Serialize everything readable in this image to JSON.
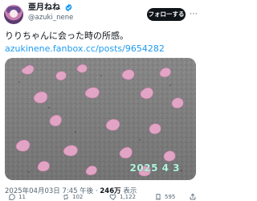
{
  "profile": {
    "display_name": "亜月ねね",
    "handle": "@azuki_nene",
    "verified": true,
    "follow_label": "フォローする",
    "more_icon": "more-icon"
  },
  "tweet": {
    "text": "りりちゃんに会った時の所感。",
    "link": "azukinene.fanbox.cc/posts/9654282",
    "media": {
      "type": "photo",
      "stamp_text": "2025 4 3"
    },
    "meta": {
      "timestamp": "2025年04月03日 7:45 午後",
      "separator": " · ",
      "views_count": "246万",
      "views_label": " 表示"
    },
    "actions": {
      "reply_count": "11",
      "retweet_count": "102",
      "like_count": "1,122",
      "bookmark_count": "595"
    }
  }
}
